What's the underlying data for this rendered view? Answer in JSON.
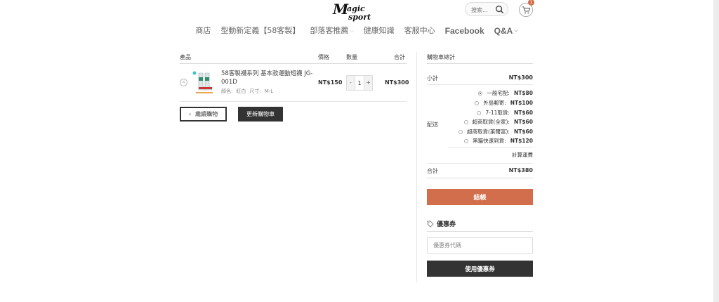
{
  "header": {
    "logo_alt": "Magic sport",
    "search": {
      "placeholder": "搜索..."
    },
    "cart_count": "1"
  },
  "nav": [
    {
      "label": "商店",
      "dropdown": false
    },
    {
      "label": "型動新定義【58客製】",
      "dropdown": false
    },
    {
      "label": "部落客推薦",
      "dropdown": true
    },
    {
      "label": "健康知識",
      "dropdown": false
    },
    {
      "label": "客服中心",
      "dropdown": false
    },
    {
      "label": "Facebook",
      "dropdown": false
    },
    {
      "label": "Q&A",
      "dropdown": true
    }
  ],
  "cart": {
    "headers": {
      "product": "產品",
      "price": "價格",
      "qty": "數量",
      "subtotal": "合計"
    },
    "item": {
      "name": "58客製襪系列 基本款運動短襪 JG-001D",
      "color_label": "顏色:",
      "color_value": "紅白",
      "size_label": "尺寸:",
      "size_value": "M-L",
      "price": "NT$150",
      "qty": "1",
      "subtotal": "NT$300"
    },
    "continue_label": "繼續購物",
    "continue_arrow": "‹",
    "update_label": "更新購物車"
  },
  "totals": {
    "title": "購物車總計",
    "subtotal_label": "小計",
    "subtotal_value": "NT$300",
    "shipping_label": "配送",
    "shipping_options": [
      {
        "label": "一般宅配:",
        "price": "NT$80",
        "selected": true
      },
      {
        "label": "外島郵寄:",
        "price": "NT$100",
        "selected": false
      },
      {
        "label": "7-11取貨:",
        "price": "NT$60",
        "selected": false
      },
      {
        "label": "超商取貨(全家):",
        "price": "NT$60",
        "selected": false
      },
      {
        "label": "超商取貨(萊爾富):",
        "price": "NT$60",
        "selected": false
      },
      {
        "label": "黑貓快速到貨:",
        "price": "NT$120",
        "selected": false
      }
    ],
    "calc_label": "計算運費",
    "total_label": "合計",
    "total_value": "NT$380",
    "checkout_label": "結帳"
  },
  "coupon": {
    "title": "優惠券",
    "placeholder": "優惠券代碼",
    "apply_label": "使用優惠券"
  },
  "colors": {
    "accent": "#d26e4b",
    "dark": "#333333"
  }
}
